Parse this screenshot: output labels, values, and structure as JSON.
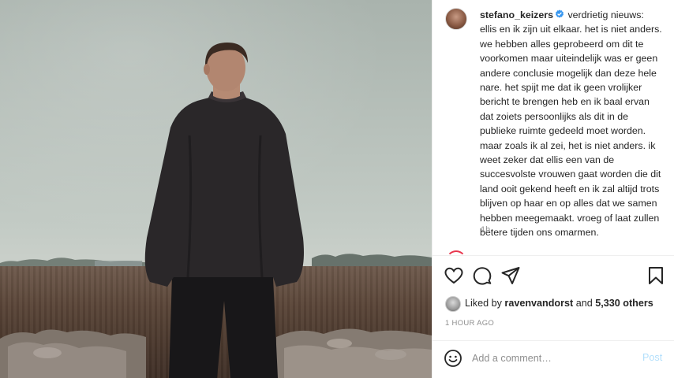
{
  "post": {
    "username": "stefano_keizers",
    "caption": "verdrietig nieuws: ellis en ik zijn uit elkaar. het is niet anders. we hebben alles geprobeerd om dit te voorkomen maar uiteindelijk was er geen andere conclusie mogelijk dan deze hele nare. het spijt me dat ik geen vrolijker bericht te brengen heb en ik baal ervan dat zoiets persoonlijks als dit in de publieke ruimte gedeeld moet worden. maar zoals ik al zei, het is niet anders. ik weet zeker dat ellis een van de succesvolste vrouwen gaat worden die dit land ooit gekend heeft en ik zal altijd trots blijven op haar en op alles dat we samen hebben meegemaakt. vroeg of laat zullen betere tijden ons omarmen.",
    "caption_age": "1h",
    "verified_icon": "verified-badge-icon"
  },
  "likes": {
    "prefix": "Liked by",
    "liker": "ravenvandorst",
    "joiner": "and",
    "others": "5,330 others"
  },
  "posted_ago": "1 HOUR AGO",
  "comment": {
    "placeholder": "Add a comment…",
    "post_label": "Post"
  },
  "colors": {
    "verified": "#3897f0",
    "post_button_disabled": "#b2dffc",
    "muted_text": "#8e8e8e"
  }
}
